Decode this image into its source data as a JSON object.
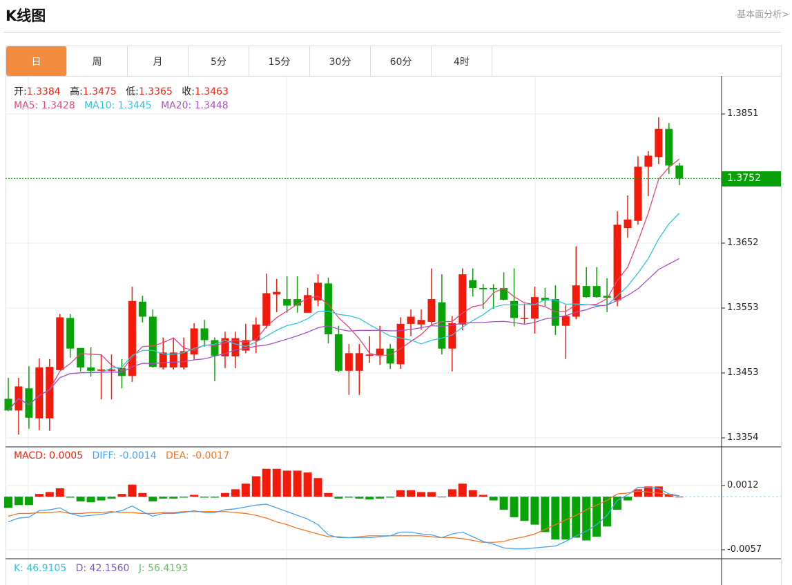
{
  "header": {
    "title": "K线图",
    "more_link": "基本面分析>"
  },
  "tabs": [
    {
      "label": "日",
      "active": true
    },
    {
      "label": "周"
    },
    {
      "label": "月"
    },
    {
      "label": "5分"
    },
    {
      "label": "15分"
    },
    {
      "label": "30分"
    },
    {
      "label": "60分"
    },
    {
      "label": "4时"
    }
  ],
  "ohlc_info": {
    "open_label": "开:",
    "open": "1.3384",
    "high_label": "高:",
    "high": "1.3475",
    "low_label": "低:",
    "low": "1.3365",
    "close_label": "收:",
    "close": "1.3463"
  },
  "ma_info": {
    "ma5": "MA5: 1.3428",
    "ma10": "MA10: 1.3445",
    "ma20": "MA20: 1.3448"
  },
  "macd_info": {
    "macd": "MACD: 0.0005",
    "diff": "DIFF: -0.0014",
    "dea": "DEA: -0.0017"
  },
  "kdj_info": {
    "k": "K: 46.9105",
    "d": "D: 42.1560",
    "j": "J: 56.4193"
  },
  "current_price": "1.3752",
  "colors": {
    "up": "#f21a0a",
    "down": "#07a307",
    "ma5": "#e8457a",
    "ma10": "#2fc4d9",
    "ma20": "#a64fc6",
    "diff": "#4aa3f0",
    "dea": "#f57322",
    "accent": "#f38c3e"
  },
  "chart_data": [
    {
      "type": "candlestick",
      "title": "K线图",
      "ylim": [
        1.3354,
        1.3851
      ],
      "y_ticks": [
        "1.3851",
        "1.3652",
        "1.3553",
        "1.3453",
        "1.3354"
      ],
      "ohlc": [
        [
          1.3414,
          1.3396,
          1.3446,
          1.3395
        ],
        [
          1.3396,
          1.3433,
          1.3446,
          1.3359
        ],
        [
          1.343,
          1.3385,
          1.3464,
          1.3368
        ],
        [
          1.3384,
          1.3462,
          1.3476,
          1.3366
        ],
        [
          1.3384,
          1.3463,
          1.3475,
          1.3365
        ],
        [
          1.3458,
          1.3539,
          1.3544,
          1.3458
        ],
        [
          1.3538,
          1.3491,
          1.3544,
          1.3477
        ],
        [
          1.3492,
          1.3462,
          1.3492,
          1.3456
        ],
        [
          1.3462,
          1.3457,
          1.3493,
          1.3448
        ],
        [
          1.3457,
          1.3459,
          1.3482,
          1.3413
        ],
        [
          1.3457,
          1.3459,
          1.3482,
          1.3413
        ],
        [
          1.3461,
          1.3449,
          1.3475,
          1.343
        ],
        [
          1.3449,
          1.3564,
          1.3586,
          1.344
        ],
        [
          1.3563,
          1.354,
          1.3572,
          1.3531
        ],
        [
          1.354,
          1.3463,
          1.3551,
          1.3462
        ],
        [
          1.3462,
          1.3485,
          1.3508,
          1.3459
        ],
        [
          1.3462,
          1.3485,
          1.3508,
          1.3459
        ],
        [
          1.3462,
          1.3487,
          1.3508,
          1.3459
        ],
        [
          1.3482,
          1.3522,
          1.353,
          1.3473
        ],
        [
          1.3522,
          1.3504,
          1.3535,
          1.3494
        ],
        [
          1.3504,
          1.348,
          1.3508,
          1.3441
        ],
        [
          1.3479,
          1.3507,
          1.3517,
          1.3461
        ],
        [
          1.3479,
          1.3507,
          1.3517,
          1.3461
        ],
        [
          1.3488,
          1.3504,
          1.3529,
          1.3484
        ],
        [
          1.3503,
          1.3528,
          1.3539,
          1.3484
        ],
        [
          1.3526,
          1.3576,
          1.3606,
          1.3522
        ],
        [
          1.3574,
          1.3578,
          1.3598,
          1.3547
        ],
        [
          1.3567,
          1.3557,
          1.3602,
          1.3546
        ],
        [
          1.3567,
          1.3557,
          1.3602,
          1.3546
        ],
        [
          1.3546,
          1.3573,
          1.3584,
          1.3546
        ],
        [
          1.3565,
          1.3592,
          1.3605,
          1.3556
        ],
        [
          1.3591,
          1.3513,
          1.36,
          1.3499
        ],
        [
          1.3513,
          1.3457,
          1.3526,
          1.3455
        ],
        [
          1.3457,
          1.3484,
          1.3498,
          1.342
        ],
        [
          1.3457,
          1.3484,
          1.3498,
          1.342
        ],
        [
          1.348,
          1.3482,
          1.351,
          1.3469
        ],
        [
          1.3481,
          1.3491,
          1.3526,
          1.3466
        ],
        [
          1.3491,
          1.3468,
          1.3498,
          1.346
        ],
        [
          1.3467,
          1.3529,
          1.3539,
          1.346
        ],
        [
          1.3529,
          1.354,
          1.3551,
          1.351
        ],
        [
          1.3528,
          1.3535,
          1.3551,
          1.352
        ],
        [
          1.3532,
          1.3567,
          1.3614,
          1.3528
        ],
        [
          1.3562,
          1.3491,
          1.3605,
          1.3482
        ],
        [
          1.3491,
          1.353,
          1.3541,
          1.3456
        ],
        [
          1.3528,
          1.3605,
          1.3614,
          1.3519
        ],
        [
          1.3596,
          1.3584,
          1.3614,
          1.3571
        ],
        [
          1.3584,
          1.3582,
          1.359,
          1.3552
        ],
        [
          1.3584,
          1.3582,
          1.359,
          1.3552
        ],
        [
          1.3584,
          1.3566,
          1.3608,
          1.3565
        ],
        [
          1.3564,
          1.3538,
          1.3614,
          1.3525
        ],
        [
          1.3537,
          1.3538,
          1.356,
          1.3529
        ],
        [
          1.3537,
          1.357,
          1.3586,
          1.3514
        ],
        [
          1.3569,
          1.3565,
          1.3584,
          1.3556
        ],
        [
          1.3567,
          1.3526,
          1.3588,
          1.3512
        ],
        [
          1.3526,
          1.3541,
          1.3558,
          1.3475
        ],
        [
          1.354,
          1.3588,
          1.3648,
          1.3536
        ],
        [
          1.3587,
          1.357,
          1.3616,
          1.3569
        ],
        [
          1.3587,
          1.357,
          1.3616,
          1.3569
        ],
        [
          1.3572,
          1.3569,
          1.3599,
          1.3547
        ],
        [
          1.3565,
          1.3681,
          1.3702,
          1.3556
        ],
        [
          1.3676,
          1.3689,
          1.3726,
          1.3661
        ],
        [
          1.3687,
          1.377,
          1.3786,
          1.3681
        ],
        [
          1.377,
          1.3787,
          1.3794,
          1.3725
        ],
        [
          1.3785,
          1.3828,
          1.3846,
          1.3774
        ],
        [
          1.3828,
          1.3772,
          1.3837,
          1.3759
        ],
        [
          1.3772,
          1.3752,
          1.3776,
          1.3742
        ]
      ],
      "ma_periods": [
        5,
        10,
        20
      ]
    },
    {
      "type": "bar+line",
      "title": "MACD",
      "ylim": [
        -0.0057,
        0.0012
      ],
      "y_ticks": [
        "0.0012",
        "-0.0057"
      ],
      "macd": [
        -0.0012,
        -0.0009,
        -0.0009,
        0.0003,
        0.0005,
        0.0009,
        -0.0001,
        -0.0005,
        -0.0006,
        -0.0004,
        -0.0002,
        0.0003,
        0.0013,
        0.0004,
        -0.0005,
        -0.0002,
        -0.0002,
        -0.0001,
        0.0002,
        -0.0001,
        -0.0001,
        0.0004,
        0.0008,
        0.0014,
        0.0022,
        0.003,
        0.003,
        0.0028,
        0.0028,
        0.0026,
        0.002,
        0.0004,
        -0.0002,
        -0.0001,
        -0.0002,
        -0.0003,
        -0.0002,
        -0.0001,
        0.0007,
        0.0007,
        0.0005,
        0.0005,
        0.0,
        0.0008,
        0.0014,
        0.0007,
        0.0002,
        -0.0004,
        -0.0014,
        -0.0022,
        -0.0026,
        -0.003,
        -0.0038,
        -0.0046,
        -0.0046,
        -0.0044,
        -0.0047,
        -0.0043,
        -0.0032,
        -0.0014,
        -0.0004,
        0.0008,
        0.0011,
        0.0011,
        0.0003,
        0.0
      ],
      "diff": [
        -0.0027,
        -0.0023,
        -0.0022,
        -0.0015,
        -0.0014,
        -0.0012,
        -0.0018,
        -0.0021,
        -0.002,
        -0.0019,
        -0.0017,
        -0.0015,
        -0.001,
        -0.0016,
        -0.0021,
        -0.0018,
        -0.0018,
        -0.0017,
        -0.0015,
        -0.0017,
        -0.0017,
        -0.0014,
        -0.0013,
        -0.0011,
        -0.0009,
        -0.0008,
        -0.0012,
        -0.0016,
        -0.002,
        -0.0024,
        -0.003,
        -0.0041,
        -0.0044,
        -0.0044,
        -0.0044,
        -0.0044,
        -0.0043,
        -0.0042,
        -0.0038,
        -0.0038,
        -0.004,
        -0.0041,
        -0.0044,
        -0.004,
        -0.0038,
        -0.0043,
        -0.0048,
        -0.0051,
        -0.0055,
        -0.0056,
        -0.0056,
        -0.0055,
        -0.0054,
        -0.0053,
        -0.0048,
        -0.0042,
        -0.0037,
        -0.003,
        -0.002,
        -0.0004,
        0.0002,
        0.001,
        0.001,
        0.0009,
        0.0003,
        0.0001
      ],
      "dea": [
        -0.0021,
        -0.0018,
        -0.0018,
        -0.0017,
        -0.0017,
        -0.0016,
        -0.0018,
        -0.0018,
        -0.0017,
        -0.0017,
        -0.0016,
        -0.0017,
        -0.0017,
        -0.0018,
        -0.0018,
        -0.0017,
        -0.0017,
        -0.0016,
        -0.0016,
        -0.0016,
        -0.0016,
        -0.0016,
        -0.0017,
        -0.0018,
        -0.002,
        -0.0023,
        -0.0027,
        -0.003,
        -0.0034,
        -0.0037,
        -0.004,
        -0.0043,
        -0.0043,
        -0.0044,
        -0.0043,
        -0.0042,
        -0.0042,
        -0.0042,
        -0.0042,
        -0.0042,
        -0.0042,
        -0.0043,
        -0.0044,
        -0.0044,
        -0.0045,
        -0.0047,
        -0.0049,
        -0.0049,
        -0.0048,
        -0.0045,
        -0.0043,
        -0.004,
        -0.0035,
        -0.003,
        -0.0025,
        -0.002,
        -0.0014,
        -0.0009,
        -0.0004,
        0.0003,
        0.0004,
        0.0006,
        0.0005,
        0.0004,
        0.0002,
        0.0001
      ]
    }
  ]
}
